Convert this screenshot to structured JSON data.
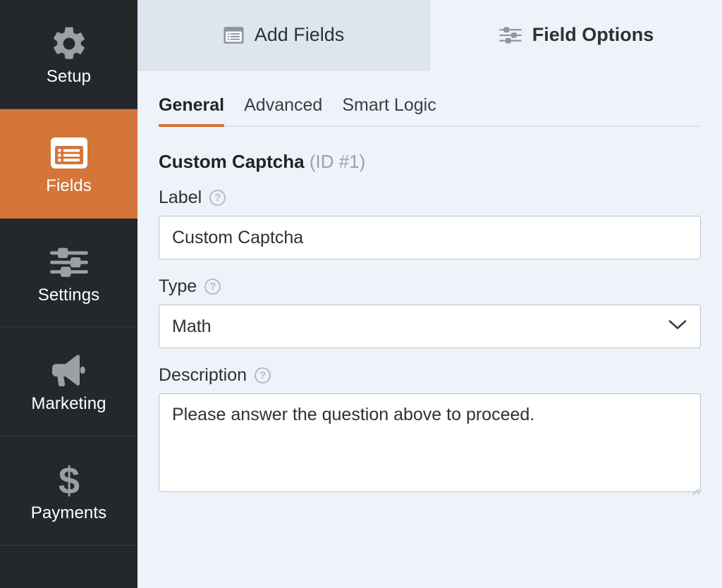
{
  "sidebar": {
    "items": [
      {
        "label": "Setup",
        "icon": "gear-icon",
        "active": false
      },
      {
        "label": "Fields",
        "icon": "list-card-icon",
        "active": true
      },
      {
        "label": "Settings",
        "icon": "sliders-icon",
        "active": false
      },
      {
        "label": "Marketing",
        "icon": "megaphone-icon",
        "active": false
      },
      {
        "label": "Payments",
        "icon": "dollar-sign-icon",
        "active": false
      }
    ],
    "active_color": "#d4753a",
    "background_color": "#25282b"
  },
  "top_tabs": [
    {
      "label": "Add Fields",
      "icon": "list-card-icon",
      "active": false
    },
    {
      "label": "Field Options",
      "icon": "sliders-icon",
      "active": true
    }
  ],
  "subtabs": [
    {
      "label": "General",
      "active": true
    },
    {
      "label": "Advanced",
      "active": false
    },
    {
      "label": "Smart Logic",
      "active": false
    }
  ],
  "field": {
    "title": "Custom Captcha",
    "id_text": "(ID #1)",
    "label": {
      "title": "Label",
      "help": "?",
      "value": "Custom Captcha"
    },
    "type": {
      "title": "Type",
      "help": "?",
      "value": "Math",
      "chevron": "chevron-down-icon"
    },
    "description": {
      "title": "Description",
      "help": "?",
      "value": "Please answer the question above to proceed."
    }
  },
  "accent_color": "#d4753a"
}
